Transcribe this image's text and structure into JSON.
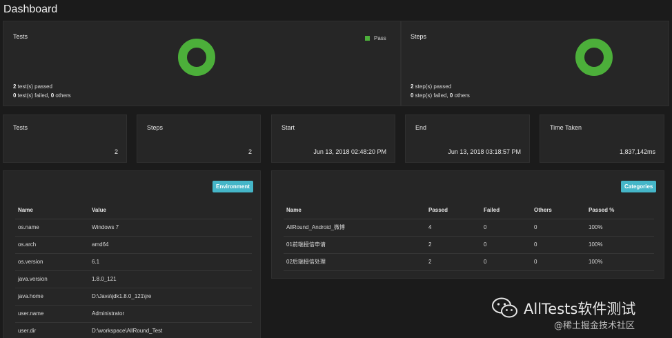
{
  "title": "Dashboard",
  "colors": {
    "pass": "#4caf3a",
    "badge": "#45b6c8"
  },
  "tests_chart": {
    "label": "Tests",
    "legend": "Pass",
    "line1_count": "2",
    "line1_text": " test(s) passed",
    "line2_failed": "0",
    "line2_mid": " test(s) failed, ",
    "line2_others": "0",
    "line2_end": " others",
    "chart_data": {
      "type": "pie",
      "categories": [
        "Pass"
      ],
      "values": [
        2
      ]
    }
  },
  "steps_chart": {
    "label": "Steps",
    "line1_count": "2",
    "line1_text": " step(s) passed",
    "line2_failed": "0",
    "line2_mid": " step(s) failed, ",
    "line2_others": "0",
    "line2_end": " others",
    "chart_data": {
      "type": "pie",
      "categories": [
        "Pass"
      ],
      "values": [
        2
      ]
    }
  },
  "stats": [
    {
      "label": "Tests",
      "value": "2"
    },
    {
      "label": "Steps",
      "value": "2"
    },
    {
      "label": "Start",
      "value": "Jun 13, 2018 02:48:20 PM"
    },
    {
      "label": "End",
      "value": "Jun 13, 2018 03:18:57 PM"
    },
    {
      "label": "Time Taken",
      "value": "1,837,142ms"
    }
  ],
  "environment": {
    "badge": "Environment",
    "headers": [
      "Name",
      "Value"
    ],
    "rows": [
      [
        "os.name",
        "Windows 7"
      ],
      [
        "os.arch",
        "amd64"
      ],
      [
        "os.version",
        "6.1"
      ],
      [
        "java.version",
        "1.8.0_121"
      ],
      [
        "java.home",
        "D:\\Java\\jdk1.8.0_121\\jre"
      ],
      [
        "user.name",
        "Administrator"
      ],
      [
        "user.dir",
        "D:\\workspace\\AllRound_Test"
      ]
    ]
  },
  "categories": {
    "badge": "Categories",
    "headers": [
      "Name",
      "Passed",
      "Failed",
      "Others",
      "Passed %"
    ],
    "rows": [
      [
        "AllRound_Android_微博",
        "4",
        "0",
        "0",
        "100%"
      ],
      [
        "01前端授信申请",
        "2",
        "0",
        "0",
        "100%"
      ],
      [
        "02后端授信处理",
        "2",
        "0",
        "0",
        "100%"
      ]
    ]
  },
  "watermark": {
    "brand": "AllTests软件测试",
    "credit": "@稀土掘金技术社区"
  }
}
